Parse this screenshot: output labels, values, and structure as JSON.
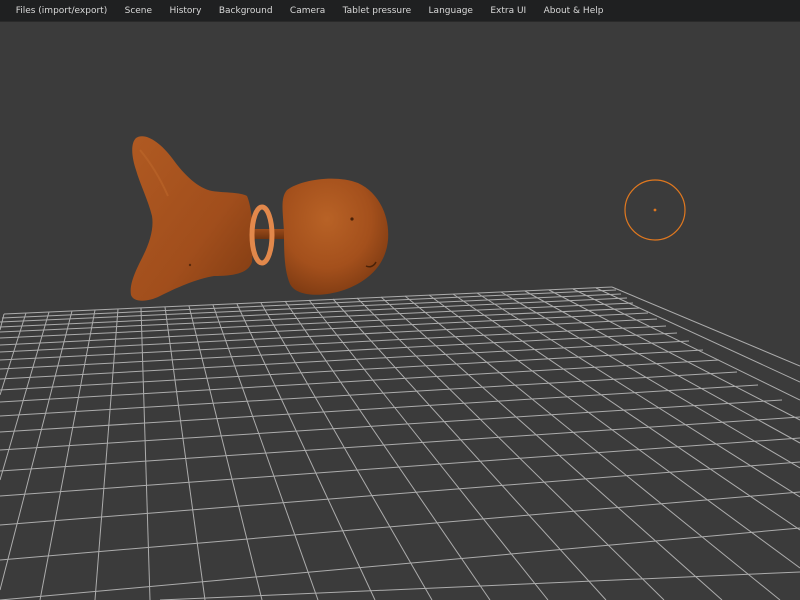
{
  "menubar": {
    "items": [
      {
        "label": "Files (import/export)"
      },
      {
        "label": "Scene"
      },
      {
        "label": "History"
      },
      {
        "label": "Background"
      },
      {
        "label": "Camera"
      },
      {
        "label": "Tablet pressure"
      },
      {
        "label": "Language"
      },
      {
        "label": "Extra UI"
      },
      {
        "label": "About & Help"
      }
    ]
  },
  "colors": {
    "background": "#3b3b3b",
    "menubar": "#1f2021",
    "grid": "#b9b9b9",
    "model": "#a8521e",
    "brush_cursor": "#e0781f"
  }
}
